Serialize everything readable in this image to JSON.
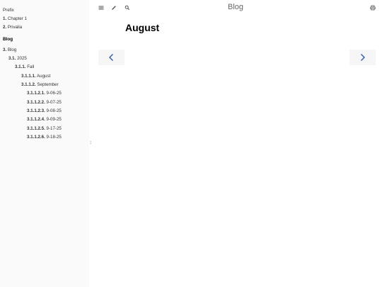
{
  "sidebar": {
    "prefix": "Prefix",
    "chapter1_num": "1.",
    "chapter1_label": "Chapter 1",
    "privalia_num": "2.",
    "privalia_label": "Privalia",
    "blog_heading": "Blog",
    "blog_num": "3.",
    "blog_label": "Blog",
    "year_num": "3.1.",
    "year_label": "2025",
    "fall_num": "3.1.1.",
    "fall_label": "Fall",
    "august_num": "3.1.1.1.",
    "august_label": "August",
    "september_num": "3.1.1.2.",
    "september_label": "September",
    "posts": [
      {
        "num": "3.1.1.2.1.",
        "label": "9-06-25"
      },
      {
        "num": "3.1.1.2.2.",
        "label": "9-07-25"
      },
      {
        "num": "3.1.1.2.3.",
        "label": "9-08-25"
      },
      {
        "num": "3.1.1.2.4.",
        "label": "9-09-25"
      },
      {
        "num": "3.1.1.2.5.",
        "label": "9-17-25"
      },
      {
        "num": "3.1.1.2.6.",
        "label": "9-18-25"
      }
    ],
    "resize_glyph": "⁝"
  },
  "topbar": {
    "title": "Blog",
    "menu_icon": "menu-icon",
    "edit_icon": "pencil-icon",
    "search_icon": "search-icon",
    "print_icon": "print-icon"
  },
  "content": {
    "title": "August"
  },
  "nav": {
    "prev_icon": "chevron-left-icon",
    "next_icon": "chevron-right-icon",
    "accent": "#2b5aa8"
  }
}
